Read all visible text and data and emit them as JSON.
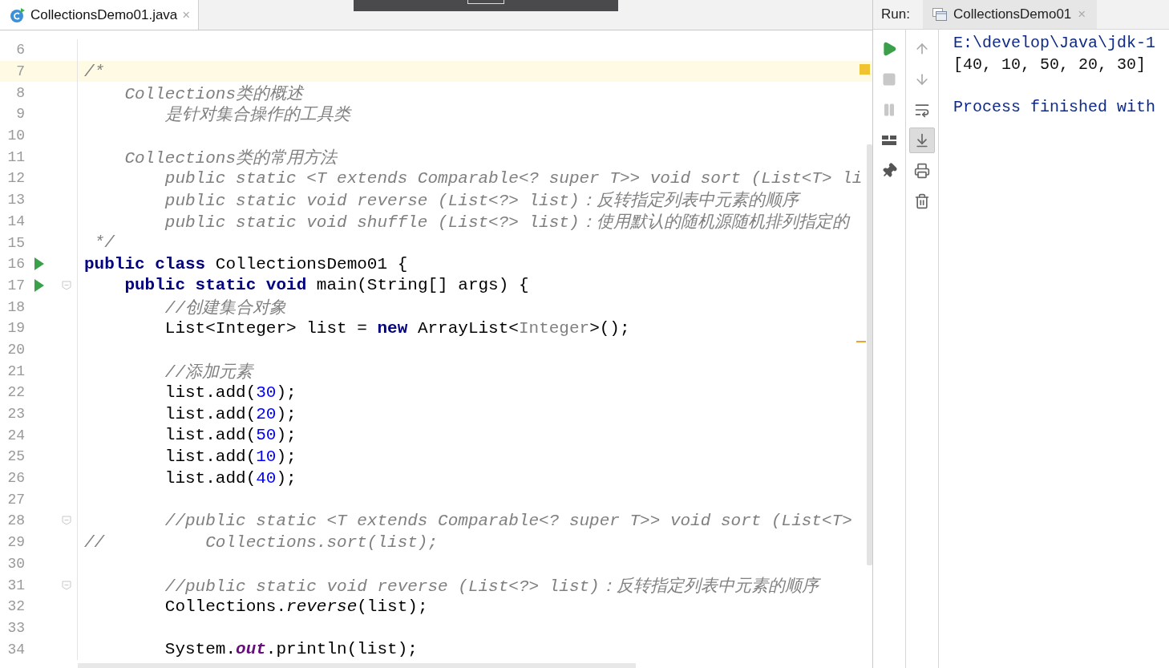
{
  "editor": {
    "tab": {
      "label": "CollectionsDemo01.java",
      "close": "×"
    },
    "lines": [
      {
        "number": "6",
        "current": false,
        "run": false,
        "fold": false
      },
      {
        "number": "7",
        "current": true,
        "run": false,
        "fold": false,
        "segments": [
          {
            "text": "/*",
            "kind": "doc"
          }
        ]
      },
      {
        "number": "8",
        "current": false,
        "run": false,
        "fold": false,
        "segments": [
          {
            "text": "    Collections类的概述",
            "kind": "doc"
          }
        ]
      },
      {
        "number": "9",
        "current": false,
        "run": false,
        "fold": false,
        "segments": [
          {
            "text": "        是针对集合操作的工具类",
            "kind": "doc"
          }
        ]
      },
      {
        "number": "10",
        "current": false,
        "run": false,
        "fold": false
      },
      {
        "number": "11",
        "current": false,
        "run": false,
        "fold": false,
        "segments": [
          {
            "text": "    Collections类的常用方法",
            "kind": "doc"
          }
        ]
      },
      {
        "number": "12",
        "current": false,
        "run": false,
        "fold": false,
        "segments": [
          {
            "text": "        public static <T extends Comparable<? super T>> void sort (List<T> li",
            "kind": "doc"
          }
        ]
      },
      {
        "number": "13",
        "current": false,
        "run": false,
        "fold": false,
        "segments": [
          {
            "text": "        public static void reverse (List<?> list)：反转指定列表中元素的顺序",
            "kind": "doc"
          }
        ]
      },
      {
        "number": "14",
        "current": false,
        "run": false,
        "fold": false,
        "segments": [
          {
            "text": "        public static void shuffle (List<?> list)：使用默认的随机源随机排列指定的",
            "kind": "doc"
          }
        ]
      },
      {
        "number": "15",
        "current": false,
        "run": false,
        "fold": false,
        "segments": [
          {
            "text": " */",
            "kind": "doc"
          }
        ]
      },
      {
        "number": "16",
        "current": false,
        "run": true,
        "fold": false,
        "segments": [
          {
            "text": "public class ",
            "kind": "keyword"
          },
          {
            "text": "CollectionsDemo01 {",
            "kind": "plain"
          }
        ]
      },
      {
        "number": "17",
        "current": false,
        "run": true,
        "fold": true,
        "segments": [
          {
            "text": "    public static void ",
            "kind": "keyword"
          },
          {
            "text": "main(String[] args) {",
            "kind": "plain"
          }
        ]
      },
      {
        "number": "18",
        "current": false,
        "run": false,
        "fold": false,
        "segments": [
          {
            "text": "        //创建集合对象",
            "kind": "comment"
          }
        ]
      },
      {
        "number": "19",
        "current": false,
        "run": false,
        "fold": false,
        "segments": [
          {
            "text": "        List<Integer> list = ",
            "kind": "plain"
          },
          {
            "text": "new ",
            "kind": "keyword"
          },
          {
            "text": "ArrayList<",
            "kind": "plain"
          },
          {
            "text": "Integer",
            "kind": "hint"
          },
          {
            "text": ">();",
            "kind": "plain"
          }
        ]
      },
      {
        "number": "20",
        "current": false,
        "run": false,
        "fold": false
      },
      {
        "number": "21",
        "current": false,
        "run": false,
        "fold": false,
        "segments": [
          {
            "text": "        //添加元素",
            "kind": "comment"
          }
        ]
      },
      {
        "number": "22",
        "current": false,
        "run": false,
        "fold": false,
        "segments": [
          {
            "text": "        list.add(",
            "kind": "plain"
          },
          {
            "text": "30",
            "kind": "number"
          },
          {
            "text": ");",
            "kind": "plain"
          }
        ]
      },
      {
        "number": "23",
        "current": false,
        "run": false,
        "fold": false,
        "segments": [
          {
            "text": "        list.add(",
            "kind": "plain"
          },
          {
            "text": "20",
            "kind": "number"
          },
          {
            "text": ");",
            "kind": "plain"
          }
        ]
      },
      {
        "number": "24",
        "current": false,
        "run": false,
        "fold": false,
        "segments": [
          {
            "text": "        list.add(",
            "kind": "plain"
          },
          {
            "text": "50",
            "kind": "number"
          },
          {
            "text": ");",
            "kind": "plain"
          }
        ]
      },
      {
        "number": "25",
        "current": false,
        "run": false,
        "fold": false,
        "segments": [
          {
            "text": "        list.add(",
            "kind": "plain"
          },
          {
            "text": "10",
            "kind": "number"
          },
          {
            "text": ");",
            "kind": "plain"
          }
        ]
      },
      {
        "number": "26",
        "current": false,
        "run": false,
        "fold": false,
        "segments": [
          {
            "text": "        list.add(",
            "kind": "plain"
          },
          {
            "text": "40",
            "kind": "number"
          },
          {
            "text": ");",
            "kind": "plain"
          }
        ]
      },
      {
        "number": "27",
        "current": false,
        "run": false,
        "fold": false
      },
      {
        "number": "28",
        "current": false,
        "run": false,
        "fold": true,
        "segments": [
          {
            "text": "        //public static <T extends Comparable<? super T>> void sort (List<T>",
            "kind": "doc"
          }
        ]
      },
      {
        "number": "29",
        "current": false,
        "run": false,
        "fold": false,
        "segments": [
          {
            "text": "//          Collections.sort(list);",
            "kind": "doc"
          }
        ]
      },
      {
        "number": "30",
        "current": false,
        "run": false,
        "fold": false
      },
      {
        "number": "31",
        "current": false,
        "run": false,
        "fold": true,
        "segments": [
          {
            "text": "        //public static void reverse (List<?> list)：反转指定列表中元素的顺序",
            "kind": "doc"
          }
        ]
      },
      {
        "number": "32",
        "current": false,
        "run": false,
        "fold": false,
        "segments": [
          {
            "text": "        Collections.",
            "kind": "plain"
          },
          {
            "text": "reverse",
            "kind": "static"
          },
          {
            "text": "(list);",
            "kind": "plain"
          }
        ]
      },
      {
        "number": "33",
        "current": false,
        "run": false,
        "fold": false
      },
      {
        "number": "34",
        "current": false,
        "run": false,
        "fold": false,
        "segments": [
          {
            "text": "        System.",
            "kind": "plain"
          },
          {
            "text": "out",
            "kind": "field"
          },
          {
            "text": ".println(list);",
            "kind": "plain"
          }
        ]
      }
    ]
  },
  "run": {
    "label": "Run:",
    "tab": {
      "label": "CollectionsDemo01",
      "close": "×"
    },
    "tools_left": [
      {
        "kind": "rerun",
        "disabled": false
      },
      {
        "kind": "stop",
        "disabled": true
      },
      {
        "kind": "pause",
        "disabled": true
      },
      {
        "kind": "layout",
        "disabled": false
      },
      {
        "kind": "pin",
        "disabled": false
      }
    ],
    "tools_right": [
      {
        "kind": "up",
        "selected": false
      },
      {
        "kind": "down",
        "selected": false
      },
      {
        "kind": "wrap",
        "selected": false
      },
      {
        "kind": "scroll-end",
        "selected": true
      },
      {
        "kind": "print",
        "selected": false
      },
      {
        "kind": "delete",
        "selected": false
      }
    ],
    "output": [
      {
        "text": "E:\\develop\\Java\\jdk-1",
        "kind": "system"
      },
      {
        "text": "[40, 10, 50, 20, 30]",
        "kind": "stdout"
      },
      {
        "kind": "blank"
      },
      {
        "text": "Process finished with",
        "kind": "system"
      }
    ]
  }
}
